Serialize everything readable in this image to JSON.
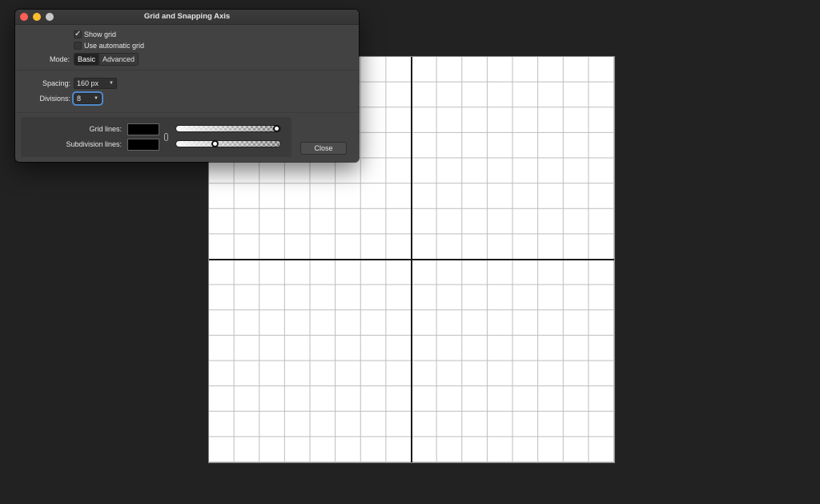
{
  "dialog": {
    "title": "Grid and Snapping Axis",
    "show_grid": {
      "label": "Show grid",
      "checked": true,
      "check_glyph": "✓"
    },
    "use_automatic_grid": {
      "label": "Use automatic grid",
      "checked": false
    },
    "mode": {
      "label": "Mode:",
      "options": [
        "Basic",
        "Advanced"
      ],
      "selected": "Basic"
    },
    "spacing": {
      "label": "Spacing:",
      "value": "160 px"
    },
    "divisions": {
      "label": "Divisions:",
      "value": "8"
    },
    "grid_lines": {
      "label": "Grid lines:",
      "color": "#000000",
      "opacity": 1.0
    },
    "subdivision_lines": {
      "label": "Subdivision lines:",
      "color": "#000000",
      "opacity": 0.38
    },
    "close_label": "Close"
  },
  "colors": {
    "traffic_close": "#fc5f57",
    "traffic_minimize": "#fdbc2e",
    "traffic_maximize": "#c9c9c9",
    "focus_ring": "#4f89c8"
  },
  "icons": {
    "caret": "▼",
    "link": "chain-link-icon"
  }
}
